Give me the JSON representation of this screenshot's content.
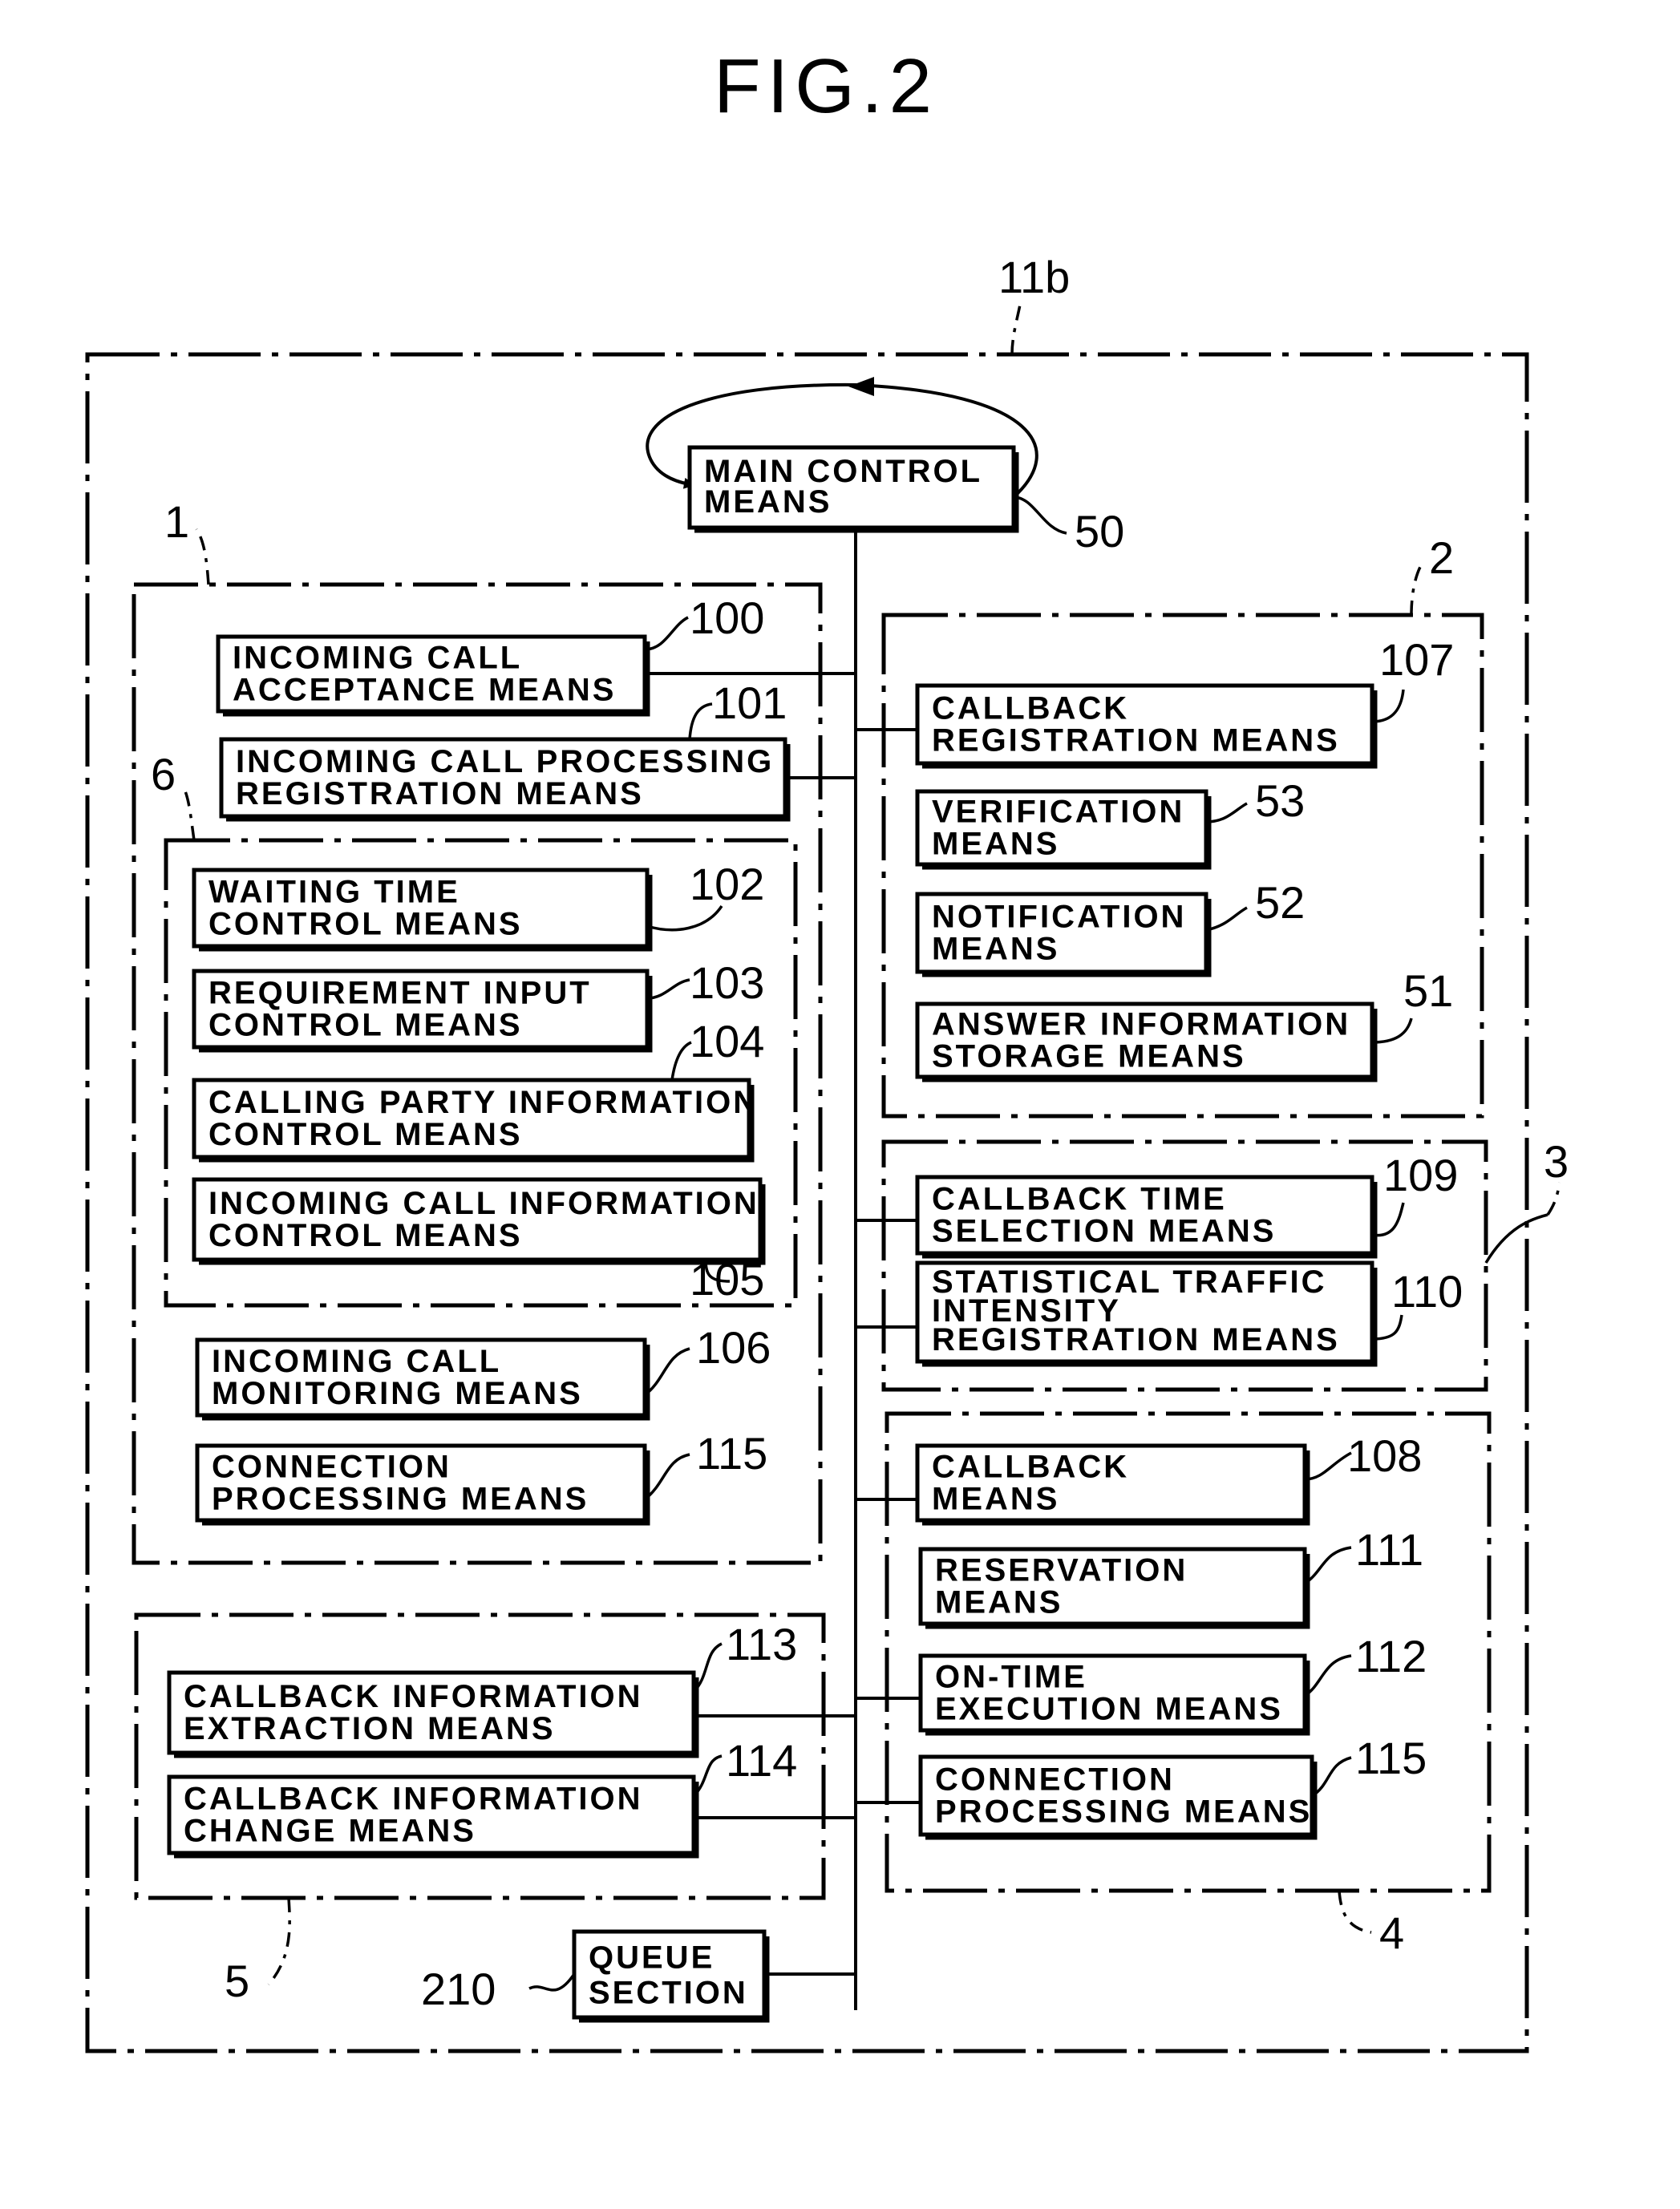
{
  "figure": {
    "title": "FIG.2",
    "outer_ref": "11b",
    "main_control": {
      "ref": "50",
      "lines": [
        "MAIN CONTROL",
        "MEANS"
      ]
    },
    "queue": {
      "ref": "210",
      "lines": [
        "QUEUE",
        "SECTION"
      ]
    },
    "groups": {
      "g1": {
        "ref": "1"
      },
      "g2": {
        "ref": "2"
      },
      "g3": {
        "ref": "3"
      },
      "g4": {
        "ref": "4"
      },
      "g5": {
        "ref": "5"
      },
      "g6": {
        "ref": "6"
      }
    },
    "boxes": {
      "b100": {
        "ref": "100",
        "lines": [
          "INCOMING CALL",
          "ACCEPTANCE MEANS"
        ]
      },
      "b101": {
        "ref": "101",
        "lines": [
          "INCOMING CALL PROCESSING",
          "REGISTRATION MEANS"
        ]
      },
      "b102": {
        "ref": "102",
        "lines": [
          "WAITING TIME",
          "CONTROL  MEANS"
        ]
      },
      "b103": {
        "ref": "103",
        "lines": [
          "REQUIREMENT INPUT",
          "CONTROL  MEANS"
        ]
      },
      "b104": {
        "ref": "104",
        "lines": [
          "CALLING PARTY INFORMATION",
          "CONTROL  MEANS"
        ]
      },
      "b105": {
        "ref": "105",
        "lines": [
          "INCOMING CALL INFORMATION",
          "CONTROL  MEANS"
        ]
      },
      "b106": {
        "ref": "106",
        "lines": [
          "INCOMING CALL",
          "MONITORING MEANS"
        ]
      },
      "b115l": {
        "ref": "115",
        "lines": [
          "CONNECTION",
          "PROCESSING MEANS"
        ]
      },
      "b113": {
        "ref": "113",
        "lines": [
          "CALLBACK INFORMATION",
          "EXTRACTION  MEANS"
        ]
      },
      "b114": {
        "ref": "114",
        "lines": [
          "CALLBACK INFORMATION",
          "CHANGE  MEANS"
        ]
      },
      "b107": {
        "ref": "107",
        "lines": [
          "CALLBACK",
          "REGISTRATION MEANS"
        ]
      },
      "b53": {
        "ref": "53",
        "lines": [
          "VERIFICATION",
          "MEANS"
        ]
      },
      "b52": {
        "ref": "52",
        "lines": [
          "NOTIFICATION",
          "MEANS"
        ]
      },
      "b51": {
        "ref": "51",
        "lines": [
          "ANSWER INFORMATION",
          "STORAGE MEANS"
        ]
      },
      "b109": {
        "ref": "109",
        "lines": [
          "CALLBACK TIME",
          "SELECTION MEANS"
        ]
      },
      "b110": {
        "ref": "110",
        "lines": [
          "STATISTICAL TRAFFIC",
          "INTENSITY",
          "REGISTRATION MEANS"
        ]
      },
      "b108": {
        "ref": "108",
        "lines": [
          "CALLBACK",
          "MEANS"
        ]
      },
      "b111": {
        "ref": "111",
        "lines": [
          "RESERVATION",
          "MEANS"
        ]
      },
      "b112": {
        "ref": "112",
        "lines": [
          "ON-TIME",
          "EXECUTION MEANS"
        ]
      },
      "b115r": {
        "ref": "115",
        "lines": [
          "CONNECTION",
          "PROCESSING MEANS"
        ]
      }
    }
  }
}
